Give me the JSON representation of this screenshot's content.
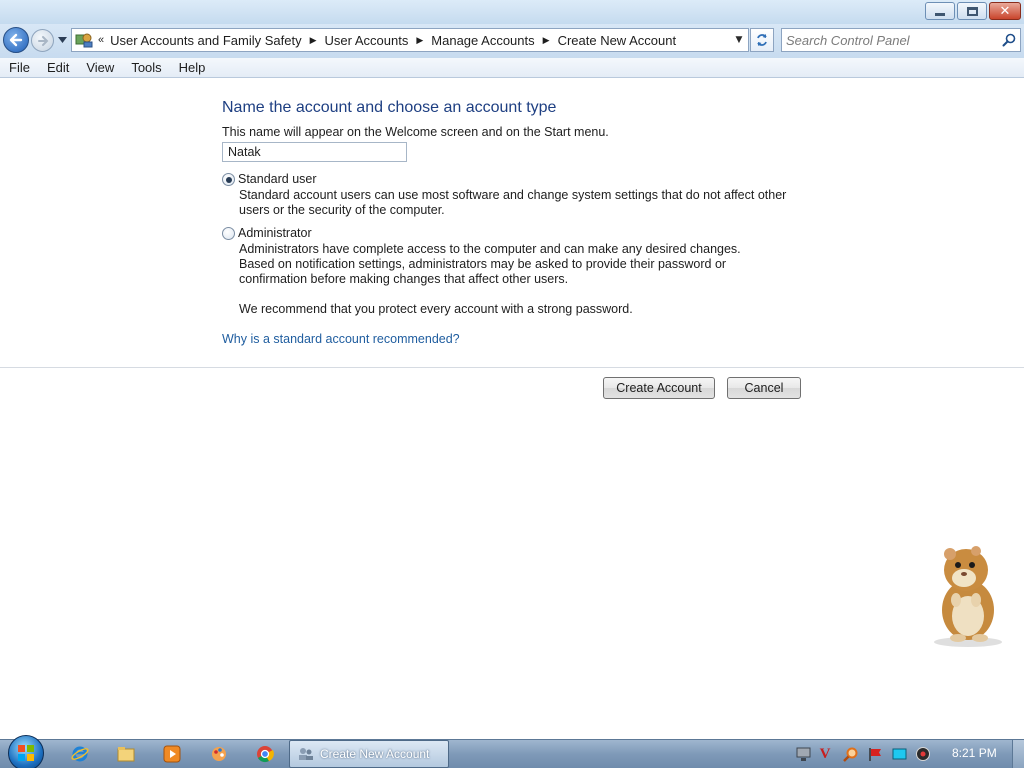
{
  "window": {
    "title_bar": {
      "minimize_icon": "minimize-icon",
      "maximize_icon": "maximize-icon",
      "close_icon": "close-icon"
    }
  },
  "address_bar": {
    "overflow_glyph": "«",
    "breadcrumbs": [
      "User Accounts and Family Safety",
      "User Accounts",
      "Manage Accounts",
      "Create New Account"
    ],
    "search_placeholder": "Search Control Panel"
  },
  "menu": {
    "items": [
      "File",
      "Edit",
      "View",
      "Tools",
      "Help"
    ]
  },
  "form": {
    "heading": "Name the account and choose an account type",
    "intro": "This name will appear on the Welcome screen and on the Start menu.",
    "account_name": "Natak",
    "options": [
      {
        "label": "Standard user",
        "selected": true,
        "description": "Standard account users can use most software and change system settings that do not affect other users or the security of the computer."
      },
      {
        "label": "Administrator",
        "selected": false,
        "description": "Administrators have complete access to the computer and can make any desired changes. Based on notification settings, administrators may be asked to provide their password or confirmation before making changes that affect other users."
      }
    ],
    "recommendation": "We recommend that you protect every account with a strong password.",
    "help_link": "Why is a standard account recommended?",
    "create_button": "Create Account",
    "cancel_button": "Cancel"
  },
  "taskbar": {
    "pinned": [
      "internet-explorer-icon",
      "windows-explorer-icon",
      "media-player-icon",
      "paint-icon",
      "chrome-icon"
    ],
    "active_task": "Create New Account",
    "tray": [
      "network-icon",
      "antivirus-icon",
      "search-tool-icon",
      "flag-icon",
      "display-icon",
      "volume-icon"
    ],
    "clock": "8:21 PM"
  },
  "colors": {
    "heading": "#1e3f82",
    "link": "#1f5d9f",
    "taskbar": "#7f9ab8"
  }
}
